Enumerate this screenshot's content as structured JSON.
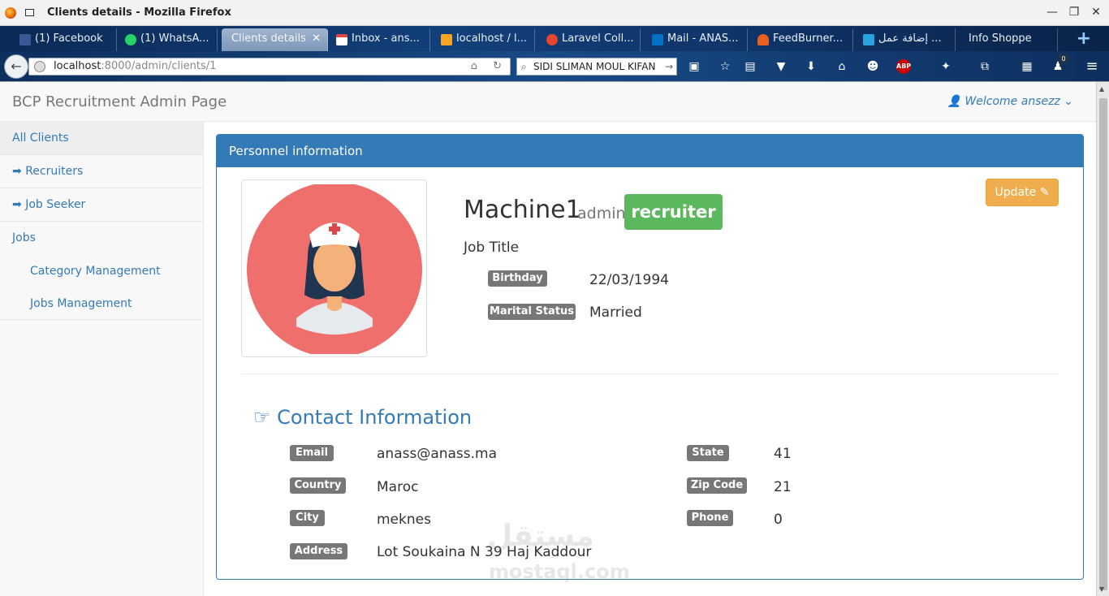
{
  "browser": {
    "window_title": "Clients details - Mozilla Firefox",
    "tabs": [
      {
        "label": "(1) Facebook"
      },
      {
        "label": "(1) WhatsA..."
      },
      {
        "label": "Clients details"
      },
      {
        "label": "Inbox - ans..."
      },
      {
        "label": "localhost / l..."
      },
      {
        "label": "Laravel Coll..."
      },
      {
        "label": "Mail - ANAS..."
      },
      {
        "label": "FeedBurner..."
      },
      {
        "label": "إضافة عمل ..."
      },
      {
        "label": "Info Shoppe"
      }
    ],
    "url_host": "localhost",
    "url_rest": ":8000/admin/clients/1",
    "search_value": "SIDI SLIMAN MOUL KIFAN",
    "notification_count": "0"
  },
  "app": {
    "brand": "BCP Recruitment Admin Page",
    "welcome": "Welcome ansezz"
  },
  "sidebar": {
    "items": [
      {
        "label": "All Clients"
      },
      {
        "label": "Recruiters"
      },
      {
        "label": "Job Seeker"
      },
      {
        "label": "Jobs"
      }
    ],
    "subitems": [
      {
        "label": "Category Management"
      },
      {
        "label": "Jobs Management"
      }
    ]
  },
  "panel": {
    "heading": "Personnel information",
    "update_label": "Update"
  },
  "profile": {
    "name": "Machine1",
    "role_small": "admin",
    "role_badge": "recruiter",
    "job_title": "Job Title",
    "birthday_label": "Birthday",
    "birthday": "22/03/1994",
    "marital_label": "Marital Status",
    "marital": "Married"
  },
  "contact": {
    "title": "Contact Information",
    "email_label": "Email",
    "email": "anass@anass.ma",
    "country_label": "Country",
    "country": "Maroc",
    "city_label": "City",
    "city": "meknes",
    "address_label": "Address",
    "address": "Lot Soukaina N 39 Haj Kaddour",
    "state_label": "State",
    "state": "41",
    "zip_label": "Zip Code",
    "zip": "21",
    "phone_label": "Phone",
    "phone": "0"
  },
  "watermark": {
    "line1": "مستقل",
    "line2": "mostaql.com"
  },
  "colors": {
    "primary": "#337ab7",
    "success": "#5cb85c",
    "warning": "#f0ad4e",
    "label": "#777777"
  }
}
